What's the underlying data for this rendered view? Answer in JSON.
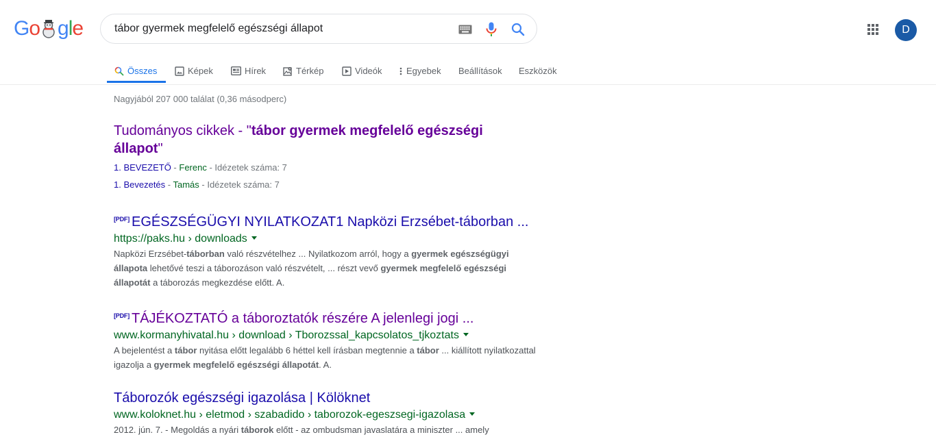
{
  "search": {
    "query": "tábor gyermek megfelelő egészségi állapot"
  },
  "header": {
    "logo": {
      "g1": "G",
      "o1": "o",
      "g2": "g",
      "l": "l",
      "e": "e"
    },
    "avatar_letter": "D"
  },
  "tabs": [
    {
      "label": "Összes",
      "icon": "search-icon",
      "active": true
    },
    {
      "label": "Képek",
      "icon": "image-icon"
    },
    {
      "label": "Hírek",
      "icon": "news-icon"
    },
    {
      "label": "Térkép",
      "icon": "map-icon"
    },
    {
      "label": "Videók",
      "icon": "video-icon"
    },
    {
      "label": "Egyebek",
      "icon": "more-vert-icon"
    },
    {
      "label": "Beállítások"
    },
    {
      "label": "Eszközök"
    }
  ],
  "stats": "Nagyjából 207 000 találat (0,36 másodperc)",
  "scholar": {
    "title_prefix": "Tudományos cikkek - \"",
    "title_bold": "tábor gyermek megfelelő egészségi állapot",
    "title_suffix": "\"",
    "items": [
      {
        "link": "1. BEVEZETŐ",
        "sep1": " - ",
        "author": "Ferenc",
        "sep2": " - ",
        "cites": "Idézetek száma: 7"
      },
      {
        "link": "1. Bevezetés",
        "sep1": " - ",
        "author": "Tamás",
        "sep2": " - ",
        "cites": "Idézetek száma: 7"
      }
    ]
  },
  "results": [
    {
      "pdf": "[PDF]",
      "title": "EGÉSZSÉGÜGYI NYILATKOZAT1 Napközi Erzsébet-táborban ...",
      "url": "https://paks.hu › downloads",
      "snippet": [
        {
          "t": "Napközi Erzsébet-"
        },
        {
          "t": "táborban",
          "b": true
        },
        {
          "t": " való részvételhez ... Nyilatkozom arról, hogy a "
        },
        {
          "t": "gyermek",
          "b": true
        },
        {
          "t": " "
        },
        {
          "t": "egészségügyi állapota",
          "b": true
        },
        {
          "t": " lehetővé teszi a táborozáson való részvételt, ... részt vevő "
        },
        {
          "t": "gyermek",
          "b": true
        },
        {
          "t": " "
        },
        {
          "t": "megfelelő egészségi állapotát",
          "b": true
        },
        {
          "t": " a táborozás megkezdése előtt. A."
        }
      ]
    },
    {
      "pdf": "[PDF]",
      "title": "TÁJÉKOZTATÓ a táboroztatók részére A jelenlegi jogi ...",
      "url": "www.kormanyhivatal.hu › download › Tborozssal_kapcsolatos_tjkoztats",
      "visited": true,
      "snippet": [
        {
          "t": "A bejelentést a "
        },
        {
          "t": "tábor",
          "b": true
        },
        {
          "t": " nyitása előtt legalább 6 héttel kell írásban megtennie a "
        },
        {
          "t": "tábor",
          "b": true
        },
        {
          "t": " ... kiállított "
        },
        {
          "t": "nyilatkozattal igazolja a "
        },
        {
          "t": "gyermek megfelelő egészségi állapotát",
          "b": true
        },
        {
          "t": ". A."
        }
      ]
    },
    {
      "title": "Táborozók egészségi igazolása | Kölöknet",
      "url": "www.koloknet.hu › eletmod › szabadido › taborozok-egeszsegi-igazolasa",
      "snippet": [
        {
          "t": "2012. jún. 7. - Megoldás a nyári "
        },
        {
          "t": "táborok",
          "b": true
        },
        {
          "t": " előtt - az ombudsman javaslatára a miniszter ... amely"
        }
      ]
    }
  ],
  "colors": {
    "link": "#1a0dab",
    "visited": "#660099",
    "url": "#006621",
    "accent": "#1a73e8",
    "avatar": "#1a5aa6"
  }
}
